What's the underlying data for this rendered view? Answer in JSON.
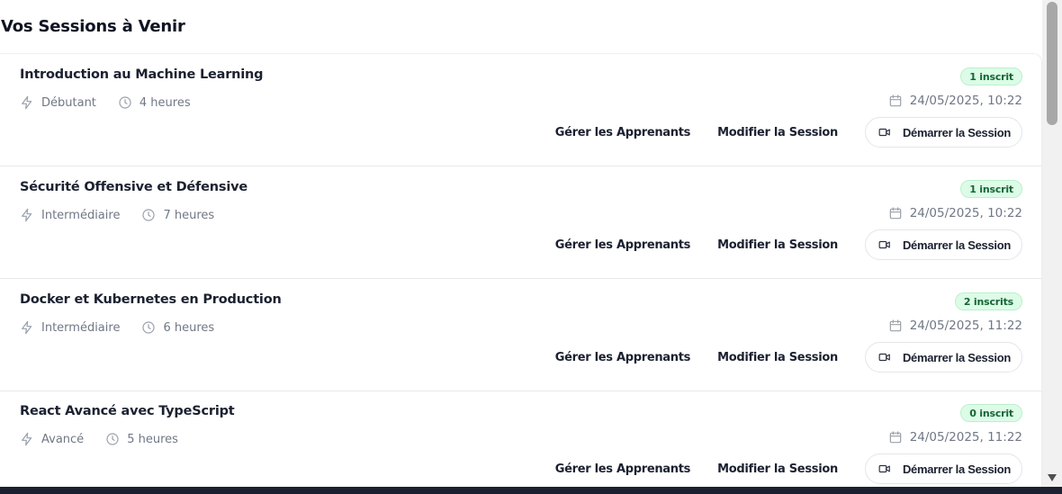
{
  "page": {
    "title": "Vos Sessions à Venir"
  },
  "labels": {
    "manage_learners": "Gérer les Apprenants",
    "edit_session": "Modifier la Session",
    "start_session": "Démarrer la Session"
  },
  "icons": {
    "level": "lightning-icon",
    "duration": "clock-icon",
    "date": "calendar-icon",
    "start": "video-camera-icon",
    "scroll_down": "arrow-down-icon"
  },
  "colors": {
    "badge_bg": "#dcfce7",
    "badge_text": "#166534",
    "muted_text": "#707785"
  },
  "sessions": [
    {
      "title": "Introduction au Machine Learning",
      "level": "Débutant",
      "duration": "4 heures",
      "enrolled": "1 inscrit",
      "datetime": "24/05/2025, 10:22"
    },
    {
      "title": "Sécurité Offensive et Défensive",
      "level": "Intermédiaire",
      "duration": "7 heures",
      "enrolled": "1 inscrit",
      "datetime": "24/05/2025, 10:22"
    },
    {
      "title": "Docker et Kubernetes en Production",
      "level": "Intermédiaire",
      "duration": "6 heures",
      "enrolled": "2 inscrits",
      "datetime": "24/05/2025, 11:22"
    },
    {
      "title": "React Avancé avec TypeScript",
      "level": "Avancé",
      "duration": "5 heures",
      "enrolled": "0 inscrit",
      "datetime": "24/05/2025, 11:22"
    }
  ]
}
